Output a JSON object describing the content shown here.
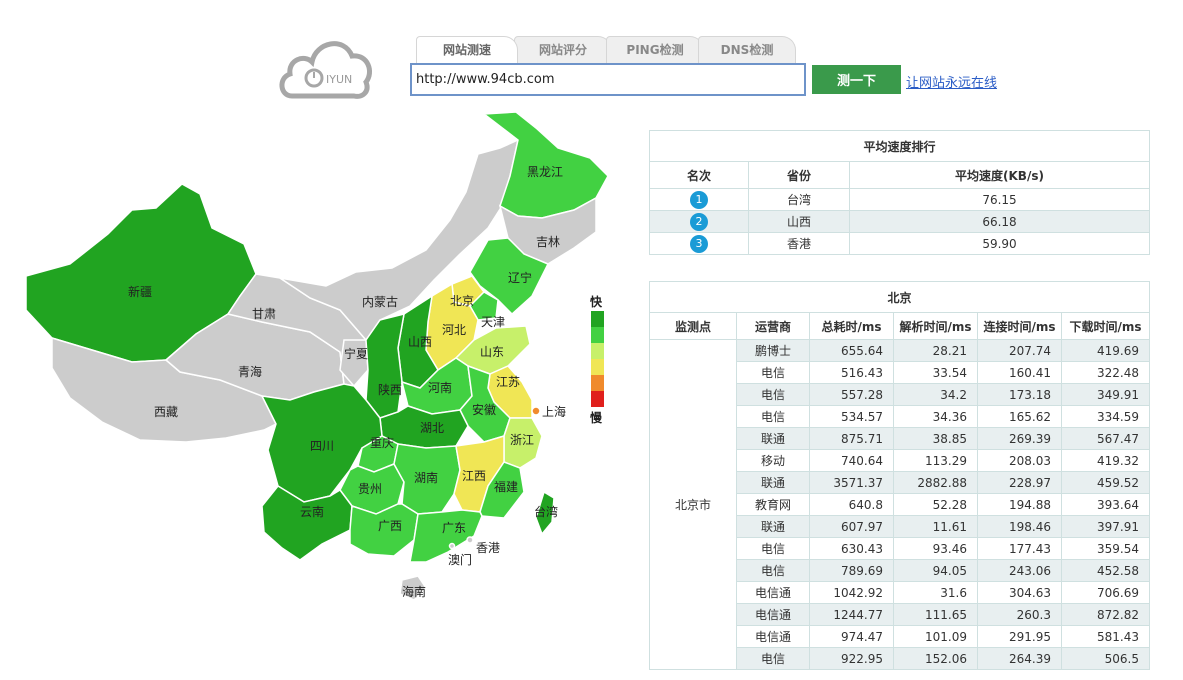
{
  "logo": {
    "text": "IYUN"
  },
  "tabs": [
    {
      "label": "网站测速",
      "active": true
    },
    {
      "label": "网站评分",
      "active": false
    },
    {
      "label": "PING检测",
      "active": false
    },
    {
      "label": "DNS检测",
      "active": false
    }
  ],
  "url_input": {
    "value": "http://www.94cb.com"
  },
  "test_button": "测一下",
  "promo_link": "让网站永远在线",
  "legend": {
    "fast": "快",
    "slow": "慢"
  },
  "colors": {
    "fastest": "#21a421",
    "fast": "#42d142",
    "medium": "#c7f06a",
    "slowish": "#f0e655",
    "slow": "#f08a2c",
    "slowest": "#e0201c",
    "nodata": "#cccccc",
    "accent": "#3a9a4b",
    "badge": "#1a9bd6"
  },
  "map": {
    "provinces": [
      {
        "name": "新疆",
        "level": "fastest"
      },
      {
        "name": "西藏",
        "level": "nodata"
      },
      {
        "name": "青海",
        "level": "nodata"
      },
      {
        "name": "甘肃",
        "level": "nodata"
      },
      {
        "name": "内蒙古",
        "level": "nodata"
      },
      {
        "name": "宁夏",
        "level": "nodata"
      },
      {
        "name": "黑龙江",
        "level": "fast"
      },
      {
        "name": "吉林",
        "level": "nodata"
      },
      {
        "name": "辽宁",
        "level": "fast"
      },
      {
        "name": "北京",
        "level": "slowish"
      },
      {
        "name": "天津",
        "level": "fast"
      },
      {
        "name": "河北",
        "level": "slowish"
      },
      {
        "name": "山西",
        "level": "fastest"
      },
      {
        "name": "山东",
        "level": "medium"
      },
      {
        "name": "陕西",
        "level": "fastest"
      },
      {
        "name": "河南",
        "level": "fast"
      },
      {
        "name": "江苏",
        "level": "slowish"
      },
      {
        "name": "上海",
        "level": "slow"
      },
      {
        "name": "安徽",
        "level": "fast"
      },
      {
        "name": "浙江",
        "level": "medium"
      },
      {
        "name": "湖北",
        "level": "fastest"
      },
      {
        "name": "四川",
        "level": "fastest"
      },
      {
        "name": "重庆",
        "level": "fast"
      },
      {
        "name": "贵州",
        "level": "fast"
      },
      {
        "name": "湖南",
        "level": "fast"
      },
      {
        "name": "江西",
        "level": "slowish"
      },
      {
        "name": "福建",
        "level": "fast"
      },
      {
        "name": "台湾",
        "level": "fastest"
      },
      {
        "name": "云南",
        "level": "fastest"
      },
      {
        "name": "广西",
        "level": "fast"
      },
      {
        "name": "广东",
        "level": "fast"
      },
      {
        "name": "香港",
        "level": "nodata"
      },
      {
        "name": "澳门",
        "level": "nodata"
      },
      {
        "name": "海南",
        "level": "nodata"
      }
    ]
  },
  "ranking": {
    "title": "平均速度排行",
    "columns": [
      "名次",
      "省份",
      "平均速度(KB/s)"
    ],
    "rows": [
      {
        "rank": "1",
        "province": "台湾",
        "speed": "76.15"
      },
      {
        "rank": "2",
        "province": "山西",
        "speed": "66.18"
      },
      {
        "rank": "3",
        "province": "香港",
        "speed": "59.90"
      }
    ]
  },
  "detail": {
    "title": "北京",
    "columns": [
      "监测点",
      "运营商",
      "总耗时/ms",
      "解析时间/ms",
      "连接时间/ms",
      "下载时间/ms"
    ],
    "location": "北京市",
    "rows": [
      {
        "isp": "鹏博士",
        "total": "655.64",
        "dns": "28.21",
        "connect": "207.74",
        "download": "419.69"
      },
      {
        "isp": "电信",
        "total": "516.43",
        "dns": "33.54",
        "connect": "160.41",
        "download": "322.48"
      },
      {
        "isp": "电信",
        "total": "557.28",
        "dns": "34.2",
        "connect": "173.18",
        "download": "349.91"
      },
      {
        "isp": "电信",
        "total": "534.57",
        "dns": "34.36",
        "connect": "165.62",
        "download": "334.59"
      },
      {
        "isp": "联通",
        "total": "875.71",
        "dns": "38.85",
        "connect": "269.39",
        "download": "567.47"
      },
      {
        "isp": "移动",
        "total": "740.64",
        "dns": "113.29",
        "connect": "208.03",
        "download": "419.32"
      },
      {
        "isp": "联通",
        "total": "3571.37",
        "dns": "2882.88",
        "connect": "228.97",
        "download": "459.52"
      },
      {
        "isp": "教育网",
        "total": "640.8",
        "dns": "52.28",
        "connect": "194.88",
        "download": "393.64"
      },
      {
        "isp": "联通",
        "total": "607.97",
        "dns": "11.61",
        "connect": "198.46",
        "download": "397.91"
      },
      {
        "isp": "电信",
        "total": "630.43",
        "dns": "93.46",
        "connect": "177.43",
        "download": "359.54"
      },
      {
        "isp": "电信",
        "total": "789.69",
        "dns": "94.05",
        "connect": "243.06",
        "download": "452.58"
      },
      {
        "isp": "电信通",
        "total": "1042.92",
        "dns": "31.6",
        "connect": "304.63",
        "download": "706.69"
      },
      {
        "isp": "电信通",
        "total": "1244.77",
        "dns": "111.65",
        "connect": "260.3",
        "download": "872.82"
      },
      {
        "isp": "电信通",
        "total": "974.47",
        "dns": "101.09",
        "connect": "291.95",
        "download": "581.43"
      },
      {
        "isp": "电信",
        "total": "922.95",
        "dns": "152.06",
        "connect": "264.39",
        "download": "506.5"
      }
    ]
  }
}
